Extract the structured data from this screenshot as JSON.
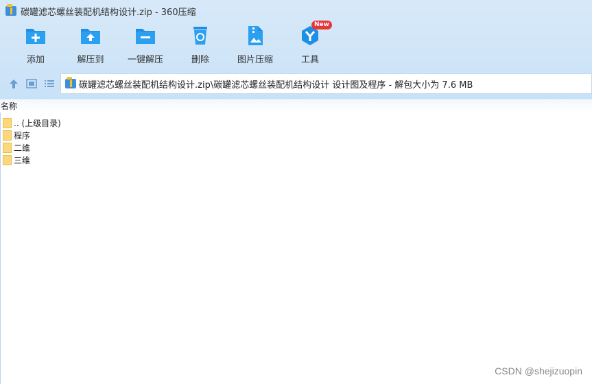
{
  "window": {
    "title": "碳罐滤芯螺丝装配机结构设计.zip - 360压缩"
  },
  "toolbar": {
    "items": [
      {
        "label": "添加",
        "icon": "add-folder-icon"
      },
      {
        "label": "解压到",
        "icon": "extract-to-icon"
      },
      {
        "label": "一键解压",
        "icon": "one-click-extract-icon"
      },
      {
        "label": "删除",
        "icon": "recycle-bin-icon"
      },
      {
        "label": "图片压缩",
        "icon": "image-compress-icon"
      },
      {
        "label": "工具",
        "icon": "tools-icon",
        "badge": "New"
      }
    ]
  },
  "nav": {
    "icons": [
      "up-arrow-icon",
      "view-thumbnail-icon",
      "view-list-icon"
    ]
  },
  "address": {
    "path": "碳罐滤芯螺丝装配机结构设计.zip\\碳罐滤芯螺丝装配机结构设计  设计图及程序 - 解包大小为 7.6 MB"
  },
  "list": {
    "column_name": "名称",
    "items": [
      {
        "name": ".. (上级目录)"
      },
      {
        "name": "程序"
      },
      {
        "name": "二维"
      },
      {
        "name": "三维"
      }
    ]
  },
  "watermark": "CSDN @shejizuopin",
  "colors": {
    "accent": "#1e8fe6",
    "badge": "#e8353a",
    "folder": "#fbd97a"
  }
}
